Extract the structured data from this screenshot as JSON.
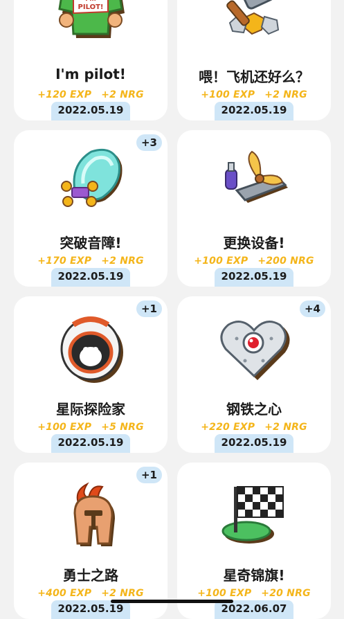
{
  "achievements": [
    {
      "title": "I'm pilot!",
      "exp": "+120 EXP",
      "nrg": "+2 NRG",
      "date": "2022.05.19",
      "badge": "",
      "icon": "pilot-shirt-icon"
    },
    {
      "title": "喂！飞机还好么？",
      "exp": "+100 EXP",
      "nrg": "+2 NRG",
      "date": "2022.05.19",
      "badge": "",
      "icon": "hammer-crash-icon"
    },
    {
      "title": "突破音障!",
      "exp": "+170 EXP",
      "nrg": "+2 NRG",
      "date": "2022.05.19",
      "badge": "+3",
      "icon": "sonic-boom-drone-icon"
    },
    {
      "title": "更换设备!",
      "exp": "+100 EXP",
      "nrg": "+200 NRG",
      "date": "2022.05.19",
      "badge": "",
      "icon": "propeller-parts-icon"
    },
    {
      "title": "星际探险家",
      "exp": "+100 EXP",
      "nrg": "+5 NRG",
      "date": "2022.05.19",
      "badge": "+1",
      "icon": "astronaut-helmet-icon"
    },
    {
      "title": "钢铁之心",
      "exp": "+220 EXP",
      "nrg": "+2 NRG",
      "date": "2022.05.19",
      "badge": "+4",
      "icon": "steel-heart-icon"
    },
    {
      "title": "勇士之路",
      "exp": "+400 EXP",
      "nrg": "+2 NRG",
      "date": "2022.05.19",
      "badge": "+1",
      "icon": "spartan-helmet-icon"
    },
    {
      "title": "星奇锦旗!",
      "exp": "+100 EXP",
      "nrg": "+20 NRG",
      "date": "2022.06.07",
      "badge": "",
      "icon": "checkered-flag-icon"
    }
  ],
  "shirt_text": "I'm PILOT!",
  "colors": {
    "badge_bg": "#cfe6f7",
    "reward": "#f4b51a",
    "card_bg": "#ffffff",
    "page_bg": "#f2f2f2"
  }
}
